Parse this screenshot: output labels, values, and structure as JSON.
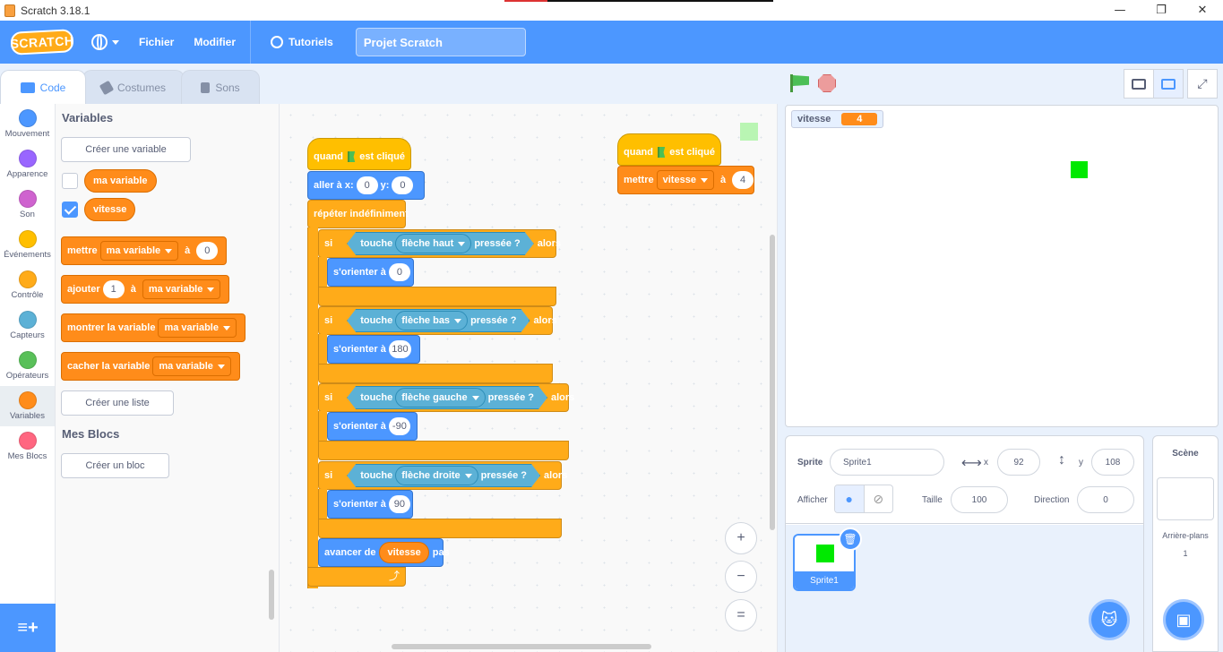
{
  "window": {
    "title": "Scratch 3.18.1",
    "controls": [
      "—",
      "❐",
      "✕"
    ]
  },
  "menubar": {
    "logo": "SCRATCH",
    "file": "Fichier",
    "edit": "Modifier",
    "tutorials": "Tutoriels",
    "project_title": "Projet Scratch"
  },
  "tabs": {
    "code": "Code",
    "costumes": "Costumes",
    "sounds": "Sons"
  },
  "categories": [
    {
      "label": "Mouvement",
      "color": "#4c97ff"
    },
    {
      "label": "Apparence",
      "color": "#9966ff"
    },
    {
      "label": "Son",
      "color": "#cf63cf"
    },
    {
      "label": "Événements",
      "color": "#ffbf00"
    },
    {
      "label": "Contrôle",
      "color": "#ffab19"
    },
    {
      "label": "Capteurs",
      "color": "#5cb1d6"
    },
    {
      "label": "Opérateurs",
      "color": "#59c059"
    },
    {
      "label": "Variables",
      "color": "#ff8c1a"
    },
    {
      "label": "Mes Blocs",
      "color": "#ff6680"
    }
  ],
  "palette": {
    "heading_variables": "Variables",
    "create_variable": "Créer une variable",
    "var1": "ma variable",
    "var2": "vitesse",
    "set_block": {
      "label": "mettre",
      "var": "ma variable",
      "to": "à",
      "value": "0"
    },
    "change_block": {
      "label": "ajouter",
      "value": "1",
      "to": "à",
      "var": "ma variable"
    },
    "show_block": {
      "label": "montrer la variable",
      "var": "ma variable"
    },
    "hide_block": {
      "label": "cacher la variable",
      "var": "ma variable"
    },
    "create_list": "Créer une liste",
    "heading_myblocks": "Mes Blocs",
    "create_block": "Créer un bloc"
  },
  "script1": {
    "hat": {
      "when": "quand",
      "clicked": "est cliqué"
    },
    "goto": {
      "label": "aller à x:",
      "x": "0",
      "ylabel": "y:",
      "y": "0"
    },
    "forever": "répéter indéfiniment",
    "ifs": [
      {
        "si": "si",
        "touch": "touche",
        "key": "flèche haut",
        "pressed": "pressée ?",
        "then": "alors",
        "point": "s'orienter à",
        "dir": "0"
      },
      {
        "si": "si",
        "touch": "touche",
        "key": "flèche bas",
        "pressed": "pressée ?",
        "then": "alors",
        "point": "s'orienter à",
        "dir": "180"
      },
      {
        "si": "si",
        "touch": "touche",
        "key": "flèche gauche",
        "pressed": "pressée ?",
        "then": "alors",
        "point": "s'orienter à",
        "dir": "-90"
      },
      {
        "si": "si",
        "touch": "touche",
        "key": "flèche droite",
        "pressed": "pressée ?",
        "then": "alors",
        "point": "s'orienter à",
        "dir": "90"
      }
    ],
    "move": {
      "label": "avancer de",
      "var": "vitesse",
      "steps": "pas"
    },
    "loop_arrow": "⤴"
  },
  "script2": {
    "hat": {
      "when": "quand",
      "clicked": "est cliqué"
    },
    "set": {
      "label": "mettre",
      "var": "vitesse",
      "to": "à",
      "value": "4"
    }
  },
  "zoom": {
    "in": "+",
    "out": "−",
    "reset": "="
  },
  "stage": {
    "monitor_name": "vitesse",
    "monitor_value": "4"
  },
  "sprite_info": {
    "sprite_label": "Sprite",
    "sprite_name": "Sprite1",
    "x_label": "x",
    "x": "92",
    "y_label": "y",
    "y": "108",
    "show_label": "Afficher",
    "size_label": "Taille",
    "size": "100",
    "direction_label": "Direction",
    "direction": "0"
  },
  "sprites": [
    {
      "name": "Sprite1"
    }
  ],
  "scene": {
    "title": "Scène",
    "backdrops_label": "Arrière-plans",
    "backdrops_count": "1"
  }
}
